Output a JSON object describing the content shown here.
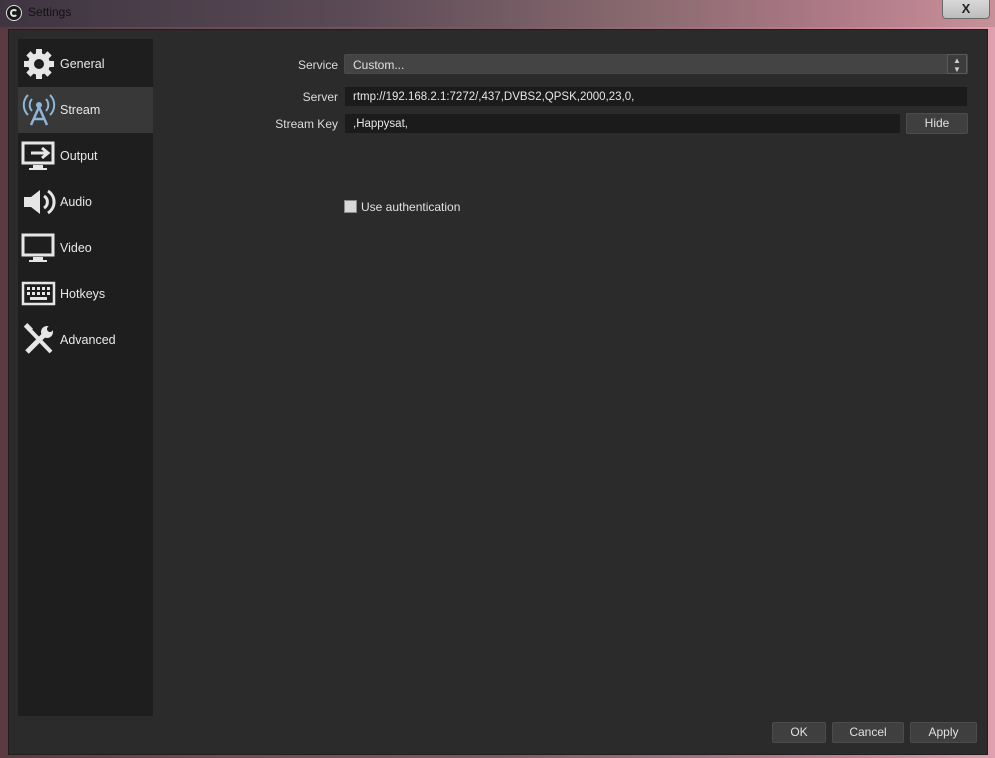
{
  "window": {
    "title": "Settings",
    "close_label": "X"
  },
  "sidebar": {
    "items": [
      {
        "label": "General",
        "icon": "gear-icon"
      },
      {
        "label": "Stream",
        "icon": "antenna-icon",
        "selected": true
      },
      {
        "label": "Output",
        "icon": "monitor-arrow-icon"
      },
      {
        "label": "Audio",
        "icon": "speaker-icon"
      },
      {
        "label": "Video",
        "icon": "monitor-icon"
      },
      {
        "label": "Hotkeys",
        "icon": "keyboard-icon"
      },
      {
        "label": "Advanced",
        "icon": "tools-icon"
      }
    ]
  },
  "stream": {
    "service_label": "Service",
    "service_value": "Custom...",
    "server_label": "Server",
    "server_value": "rtmp://192.168.2.1:7272/,437,DVBS2,QPSK,2000,23,0,",
    "key_label": "Stream Key",
    "key_value": ",Happysat,",
    "hide_label": "Hide",
    "auth_label": "Use authentication",
    "auth_checked": false
  },
  "footer": {
    "ok_label": "OK",
    "cancel_label": "Cancel",
    "apply_label": "Apply"
  }
}
